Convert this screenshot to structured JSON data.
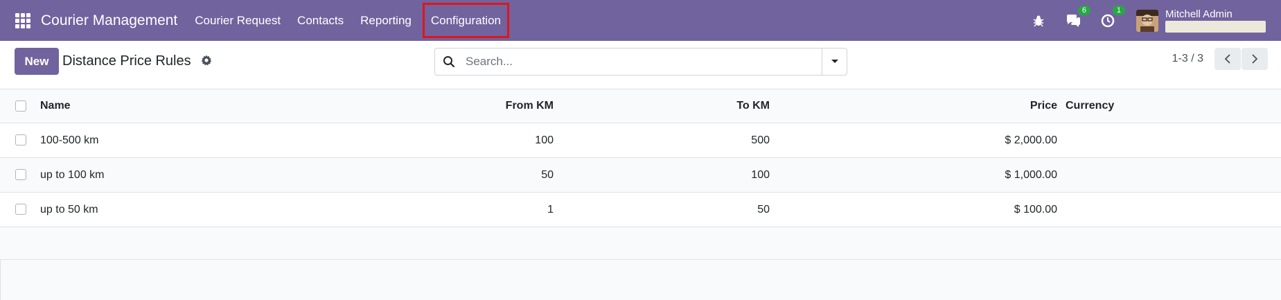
{
  "navbar": {
    "app_name": "Courier Management",
    "menu": [
      "Courier Request",
      "Contacts",
      "Reporting",
      "Configuration"
    ],
    "messages_count": "6",
    "activities_count": "1",
    "user_name": "Mitchell Admin",
    "color": "#71639e"
  },
  "control": {
    "new_label": "New",
    "title": "Distance Price Rules",
    "search_placeholder": "Search...",
    "pager": "1-3 / 3"
  },
  "table": {
    "columns": [
      "Name",
      "From KM",
      "To KM",
      "Price",
      "Currency"
    ],
    "rows": [
      {
        "name": "100-500 km",
        "from": "100",
        "to": "500",
        "price": "$ 2,000.00",
        "currency": ""
      },
      {
        "name": "up to 100 km",
        "from": "50",
        "to": "100",
        "price": "$ 1,000.00",
        "currency": ""
      },
      {
        "name": "up to 50 km",
        "from": "1",
        "to": "50",
        "price": "$ 100.00",
        "currency": ""
      }
    ]
  }
}
